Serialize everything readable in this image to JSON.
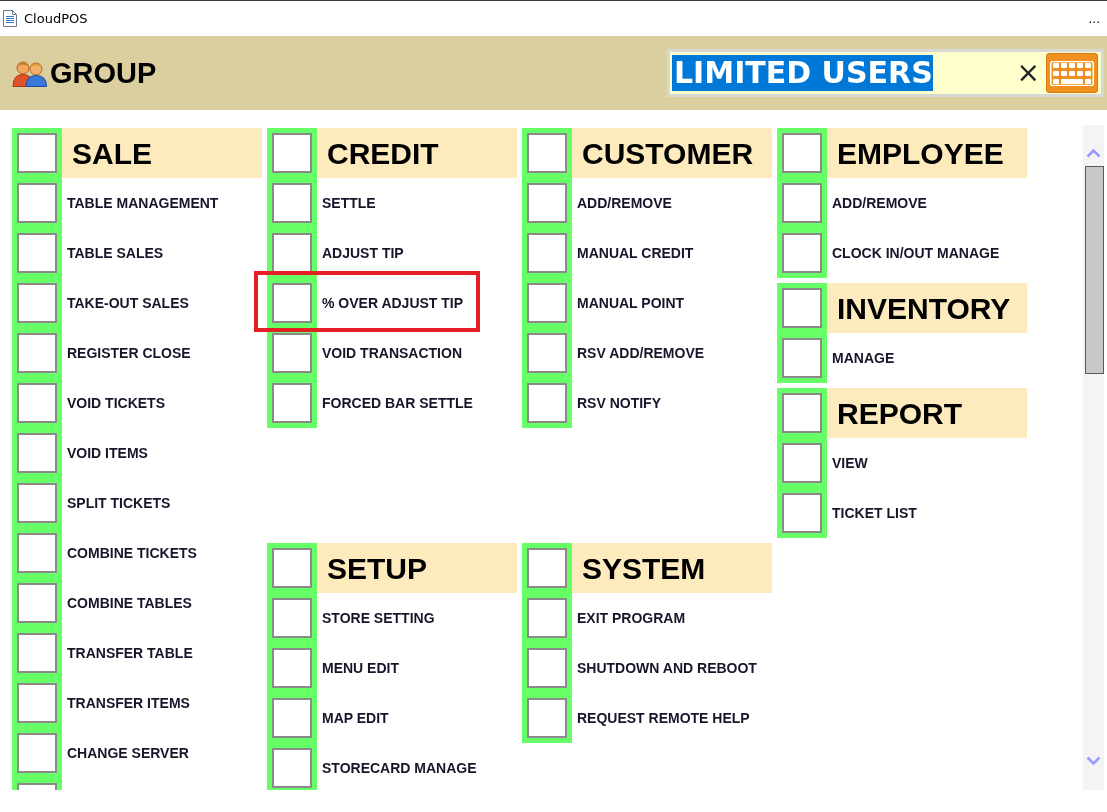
{
  "window": {
    "title": "CloudPOS",
    "more_glyph": "..."
  },
  "header": {
    "title": "GROUP",
    "search": {
      "value": "LIMITED USERS",
      "value_selected": true,
      "clear_glyph": "×"
    }
  },
  "columns": [
    {
      "groups": [
        {
          "title": "SALE",
          "checked": false,
          "items": [
            {
              "label": "TABLE MANAGEMENT",
              "checked": false
            },
            {
              "label": "TABLE SALES",
              "checked": false
            },
            {
              "label": "TAKE-OUT SALES",
              "checked": false
            },
            {
              "label": "REGISTER CLOSE",
              "checked": false
            },
            {
              "label": "VOID TICKETS",
              "checked": false
            },
            {
              "label": "VOID ITEMS",
              "checked": false
            },
            {
              "label": "SPLIT TICKETS",
              "checked": false
            },
            {
              "label": "COMBINE TICKETS",
              "checked": false
            },
            {
              "label": "COMBINE TABLES",
              "checked": false
            },
            {
              "label": "TRANSFER TABLE",
              "checked": false
            },
            {
              "label": "TRANSFER ITEMS",
              "checked": false
            },
            {
              "label": "CHANGE SERVER",
              "checked": false
            },
            {
              "checked": false
            }
          ]
        }
      ]
    },
    {
      "groups": [
        {
          "title": "CREDIT",
          "checked": false,
          "items": [
            {
              "label": "SETTLE",
              "checked": false,
              "highlighted": false
            },
            {
              "label": "ADJUST TIP",
              "checked": false,
              "highlighted": false
            },
            {
              "label": "% OVER ADJUST TIP",
              "checked": false,
              "highlighted": true
            },
            {
              "label": "VOID TRANSACTION",
              "checked": false,
              "highlighted": false
            },
            {
              "label": "FORCED BAR SETTLE",
              "checked": false,
              "highlighted": false
            }
          ]
        },
        {
          "title": "SETUP",
          "checked": false,
          "items": [
            {
              "label": "STORE SETTING",
              "checked": false
            },
            {
              "label": "MENU EDIT",
              "checked": false
            },
            {
              "label": "MAP EDIT",
              "checked": false
            },
            {
              "label": "STORECARD MANAGE",
              "checked": false
            }
          ]
        }
      ]
    },
    {
      "groups": [
        {
          "title": "CUSTOMER",
          "checked": false,
          "items": [
            {
              "label": "ADD/REMOVE",
              "checked": false
            },
            {
              "label": "MANUAL CREDIT",
              "checked": false
            },
            {
              "label": "MANUAL POINT",
              "checked": false
            },
            {
              "label": "RSV ADD/REMOVE",
              "checked": false
            },
            {
              "label": "RSV NOTIFY",
              "checked": false
            }
          ]
        },
        {
          "title": "SYSTEM",
          "checked": false,
          "items": [
            {
              "label": "EXIT PROGRAM",
              "checked": false
            },
            {
              "label": "SHUTDOWN AND REBOOT",
              "checked": false
            },
            {
              "label": "REQUEST REMOTE HELP",
              "checked": false
            }
          ]
        }
      ]
    },
    {
      "groups": [
        {
          "title": "EMPLOYEE",
          "checked": false,
          "items": [
            {
              "label": "ADD/REMOVE",
              "checked": false
            },
            {
              "label": "CLOCK IN/OUT MANAGE",
              "checked": false
            }
          ]
        },
        {
          "title": "INVENTORY",
          "checked": false,
          "items": [
            {
              "label": "MANAGE",
              "checked": false
            }
          ]
        },
        {
          "title": "REPORT",
          "checked": false,
          "items": [
            {
              "label": "VIEW",
              "checked": false
            },
            {
              "label": "TICKET LIST",
              "checked": false
            }
          ]
        }
      ]
    }
  ]
}
